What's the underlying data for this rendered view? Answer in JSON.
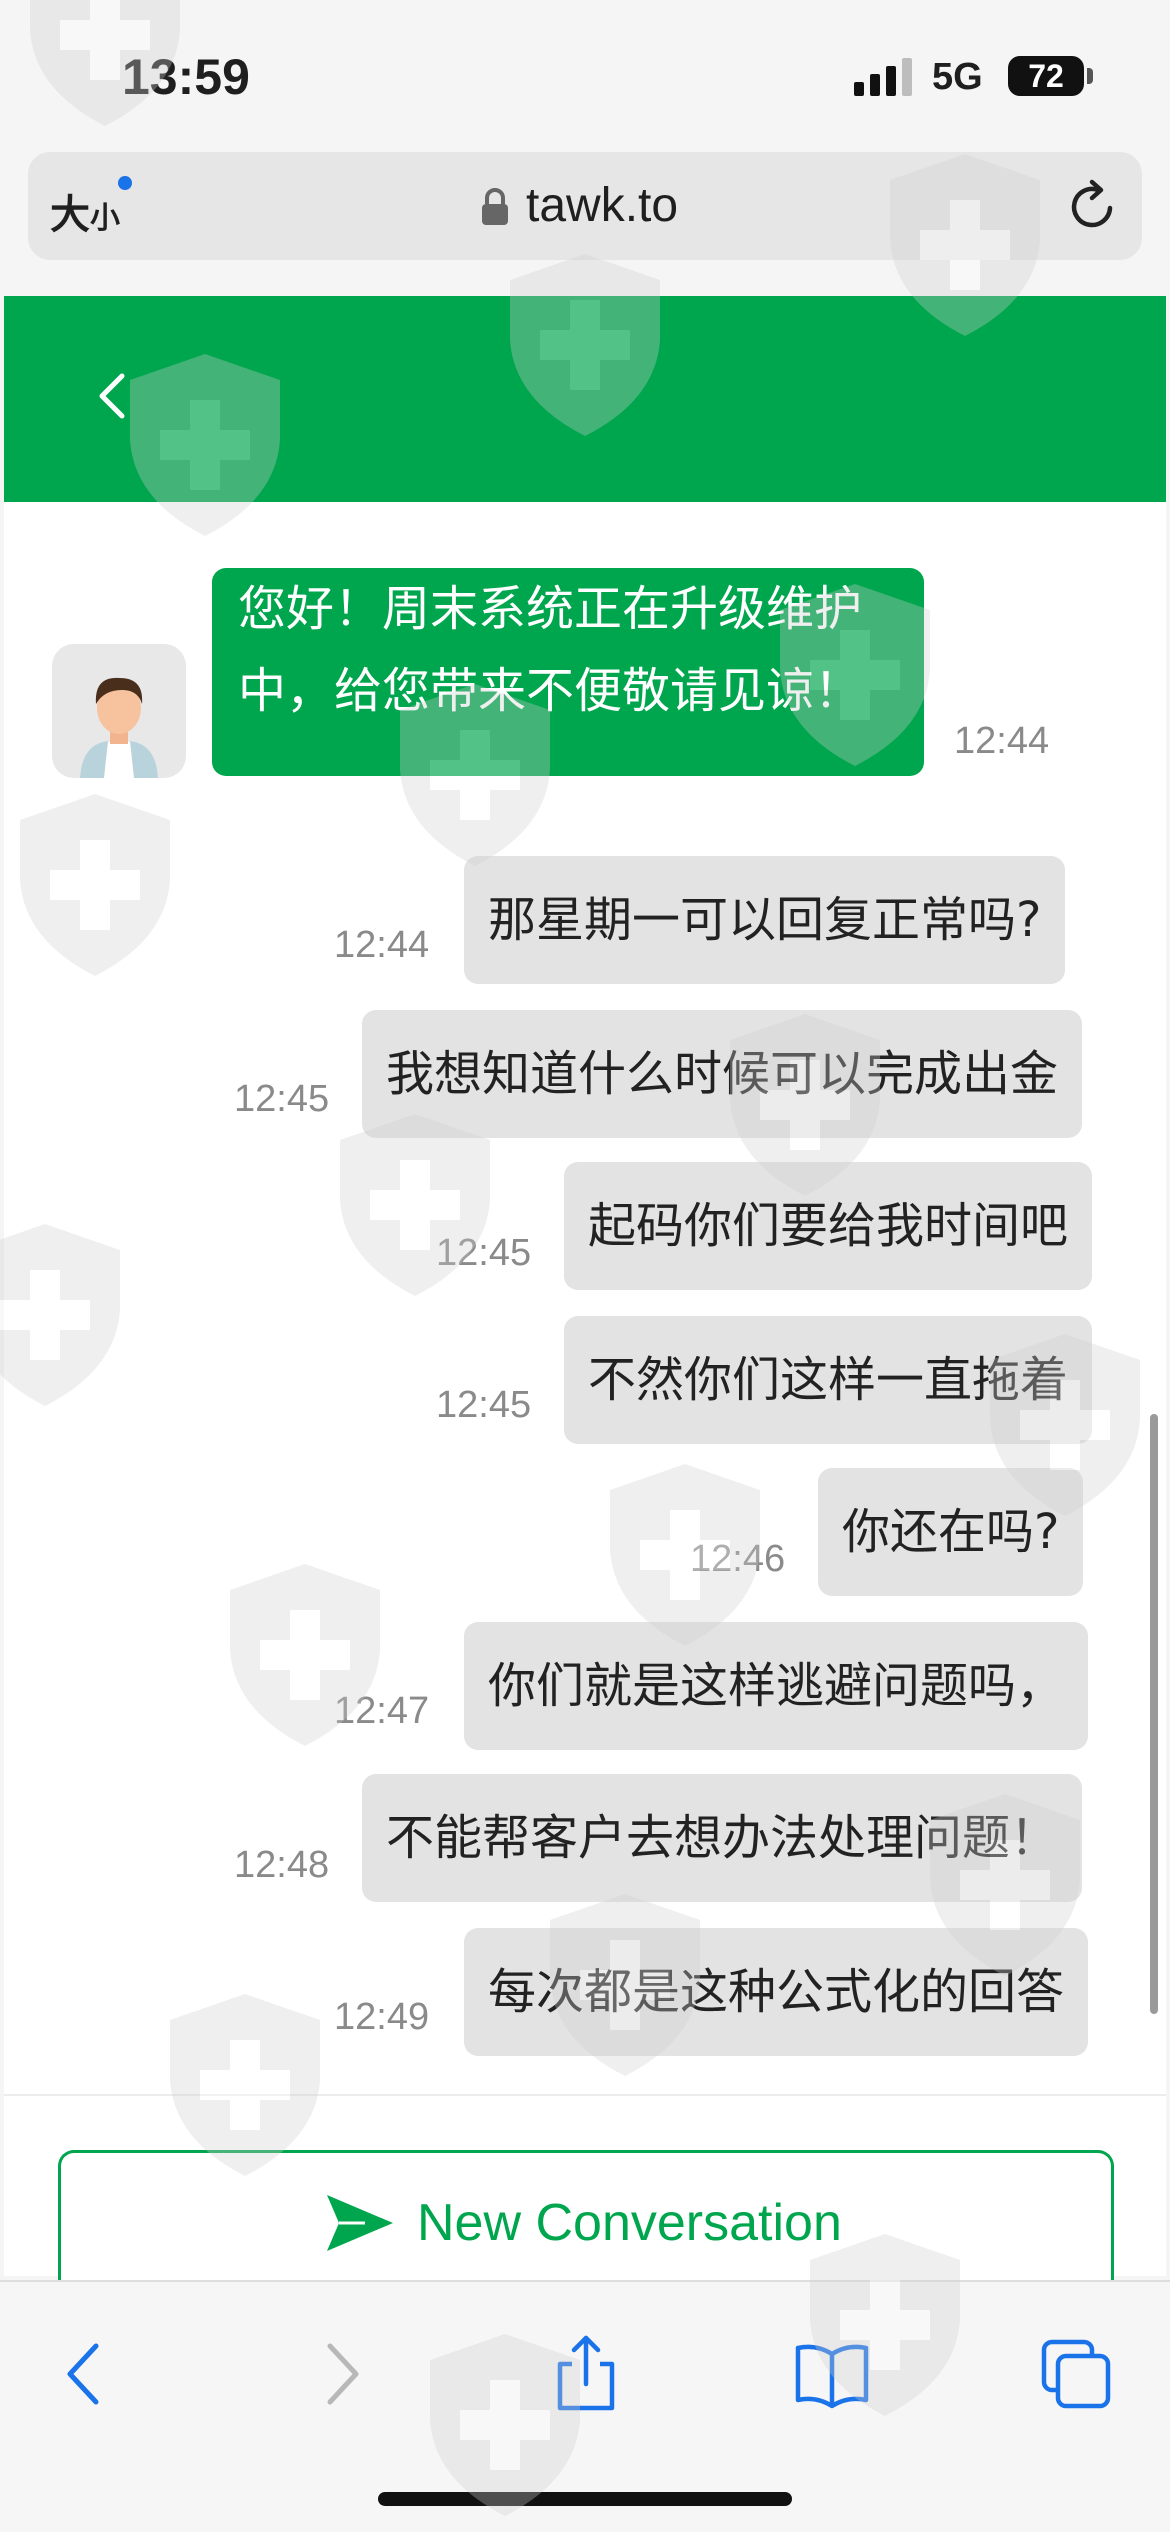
{
  "status_bar": {
    "time": "13:59",
    "network": "5G",
    "battery": "72"
  },
  "browser": {
    "text_size_label_big": "大",
    "text_size_label_small": "小",
    "url": "tawk.to"
  },
  "chat": {
    "messages": [
      {
        "sender": "agent",
        "text": "您好！周末系统正在升级维护中，给您带来不便敬请见谅！",
        "time": "12:44"
      },
      {
        "sender": "visitor",
        "text": "那星期一可以回复正常吗?",
        "time": "12:44"
      },
      {
        "sender": "visitor",
        "text": "我想知道什么时候可以完成出金",
        "time": "12:45"
      },
      {
        "sender": "visitor",
        "text": "起码你们要给我时间吧",
        "time": "12:45"
      },
      {
        "sender": "visitor",
        "text": "不然你们这样一直拖着",
        "time": "12:45"
      },
      {
        "sender": "visitor",
        "text": "你还在吗?",
        "time": "12:46"
      },
      {
        "sender": "visitor",
        "text": "你们就是这样逃避问题吗，",
        "time": "12:47"
      },
      {
        "sender": "visitor",
        "text": "不能帮客户去想办法处理问题！",
        "time": "12:48"
      },
      {
        "sender": "visitor",
        "text": "每次都是这种公式化的回答",
        "time": "12:49"
      }
    ],
    "new_conversation_label": "New Conversation"
  },
  "colors": {
    "brand_green": "#00a64e",
    "visitor_bubble": "#e3e3e3",
    "timestamp": "#8a8a8a"
  }
}
